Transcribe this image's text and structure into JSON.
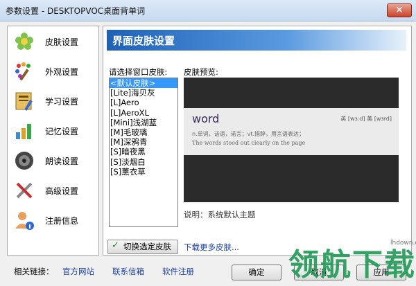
{
  "window": {
    "title": "参数设置 - DESKTOPVOC桌面背单词",
    "close_glyph": "×"
  },
  "nav": [
    {
      "label": "皮肤设置",
      "icon": "flower-icon"
    },
    {
      "label": "外观设置",
      "icon": "palette-icon"
    },
    {
      "label": "学习设置",
      "icon": "study-icon"
    },
    {
      "label": "记忆设置",
      "icon": "chart-icon"
    },
    {
      "label": "朗读设置",
      "icon": "speaker-icon"
    },
    {
      "label": "高级设置",
      "icon": "tools-icon"
    },
    {
      "label": "注册信息",
      "icon": "user-info-icon"
    }
  ],
  "main": {
    "header": "界面皮肤设置",
    "select_label": "请选择窗口皮肤:",
    "preview_label": "皮肤预览:",
    "skins": [
      "<默认皮肤>",
      "[Lite]海贝灰",
      "[L]Aero",
      "[L]AeroXL",
      "[Mini]浅湖蓝",
      "[M]毛玻璃",
      "[M]深鸦青",
      "[S]暗夜黑",
      "[S]淡烟白",
      "[S]薰衣草"
    ],
    "selected_index": 0,
    "preview": {
      "word": "word",
      "phonetic": "英 [wɜːd] 美 [wɜrd]",
      "meaning": "n.单词，话语，诺言；vt.措辞，用言语表达；",
      "example": "The words stood out clearly on the page"
    },
    "description": "说明：系统默认主题",
    "switch_button": "切换选定皮肤",
    "switch_check": "✓",
    "download_link": "下载更多皮肤..."
  },
  "footer": {
    "links_label": "相关链接：",
    "links": [
      "官方网站",
      "联系信箱",
      "软件注册"
    ],
    "ok": "确定",
    "cancel": "取消",
    "apply": "应用"
  },
  "watermark": {
    "text": "领航下载",
    "url": "lhdown.com"
  }
}
